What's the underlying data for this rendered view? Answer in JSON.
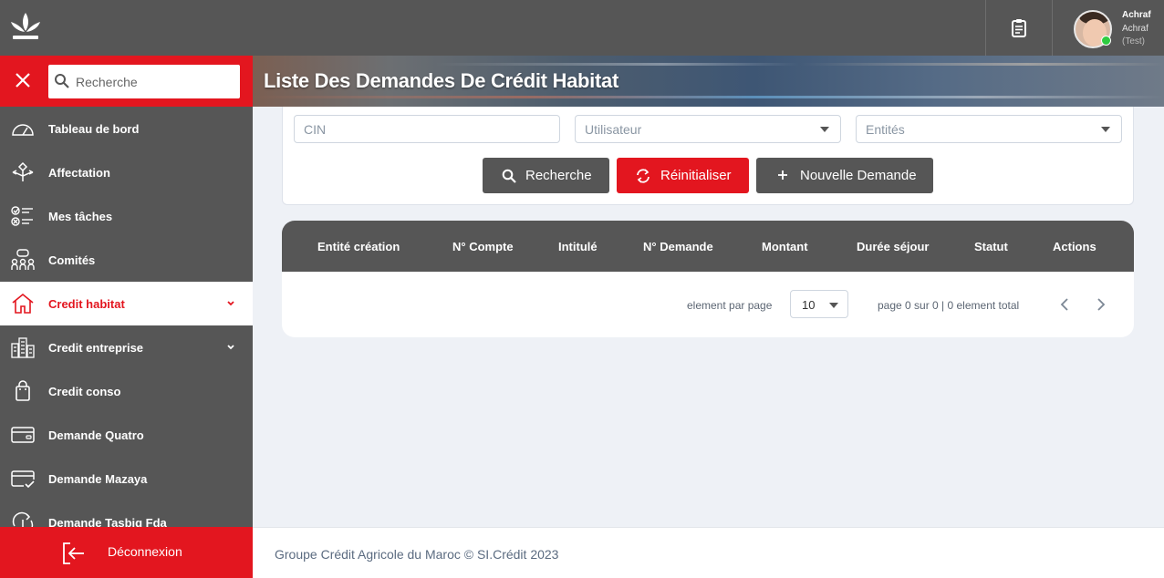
{
  "user": {
    "name": "Achraf",
    "subtitle": "Achraf",
    "tag": "(Test)"
  },
  "sidebar": {
    "search_placeholder": "Recherche",
    "items": [
      {
        "label": "Tableau de bord",
        "icon": "gauge-icon"
      },
      {
        "label": "Affectation",
        "icon": "route-icon"
      },
      {
        "label": "Mes tâches",
        "icon": "checklist-icon"
      },
      {
        "label": "Comités",
        "icon": "people-icon"
      },
      {
        "label": "Credit habitat",
        "icon": "house-icon",
        "active": true,
        "has_children": true
      },
      {
        "label": "Credit entreprise",
        "icon": "buildings-icon",
        "has_children": true
      },
      {
        "label": "Credit conso",
        "icon": "shopping-bag-icon"
      },
      {
        "label": "Demande Quatro",
        "icon": "credit-card-icon"
      },
      {
        "label": "Demande Mazaya",
        "icon": "card-check-icon"
      },
      {
        "label": "Demande Tasbiq Fda",
        "icon": "refresh-icon"
      }
    ],
    "logout_label": "Déconnexion"
  },
  "page": {
    "title": "Liste Des Demandes De Crédit Habitat"
  },
  "filters": {
    "cin_placeholder": "CIN",
    "user_placeholder": "Utilisateur",
    "entities_placeholder": "Entités",
    "search_label": "Recherche",
    "reset_label": "Réinitialiser",
    "new_label": "Nouvelle Demande"
  },
  "table": {
    "columns": [
      "Entité création",
      "N° Compte",
      "Intitulé",
      "N° Demande",
      "Montant",
      "Durée séjour",
      "Statut",
      "Actions"
    ],
    "rows": []
  },
  "pagination": {
    "per_page_label": "element par page",
    "per_page_value": "10",
    "summary": "page 0 sur 0 | 0 element total"
  },
  "footer": {
    "text": "Groupe Crédit Agricole du Maroc © SI.Crédit 2023"
  },
  "colors": {
    "brand_red": "#e3161f",
    "dark_gray": "#565656",
    "background": "#eef1f6"
  }
}
